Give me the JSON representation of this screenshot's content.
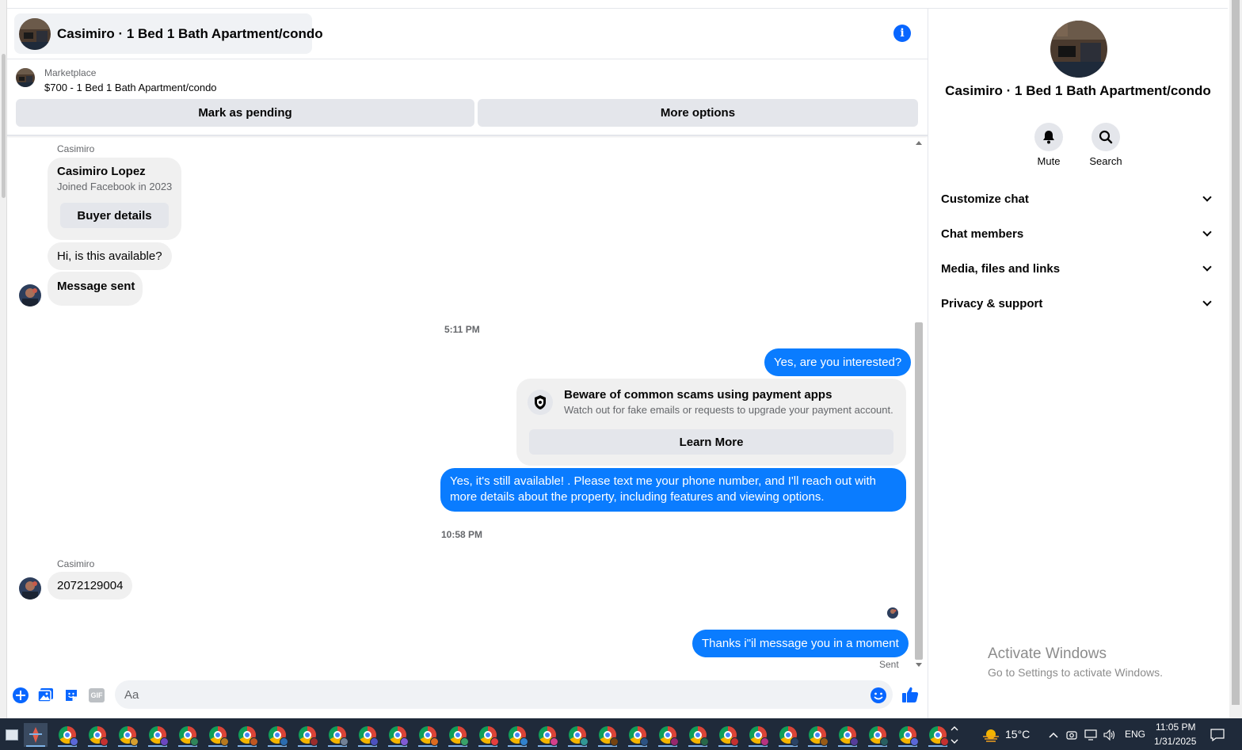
{
  "header": {
    "chat_title": "Casimiro · 1 Bed 1 Bath Apartment/condo"
  },
  "marketplace": {
    "label": "Marketplace",
    "listing": "$700 - 1 Bed 1 Bath Apartment/condo",
    "pending_button": "Mark as pending",
    "more_button": "More options"
  },
  "messages": {
    "sender_1": "Casimiro",
    "profile": {
      "name": "Casimiro Lopez",
      "joined": "Joined Facebook in 2023",
      "button": "Buyer details"
    },
    "in_1": "Hi, is this available?",
    "in_2": "Message sent",
    "time_1": "5:11 PM",
    "out_1": "Yes, are you interested?",
    "scam": {
      "title": "Beware of common scams using payment apps",
      "text": "Watch out for fake emails or requests to upgrade your payment account.",
      "button": "Learn More"
    },
    "out_2": "Yes, it's still available! . Please text me your phone number, and I'll reach out with more details about the property, including features and viewing options.",
    "time_2": "10:58 PM",
    "sender_2": "Casimiro",
    "in_3": "2072129004",
    "out_3": "Thanks i\"il message you in a moment",
    "status": "Sent"
  },
  "composer": {
    "placeholder": "Aa",
    "gif_label": "GIF"
  },
  "right_panel": {
    "title": "Casimiro · 1 Bed 1 Bath Apartment/condo",
    "mute": "Mute",
    "search": "Search",
    "sections": [
      "Customize chat",
      "Chat members",
      "Media, files and links",
      "Privacy & support"
    ]
  },
  "watermark": {
    "line1": "Activate Windows",
    "line2": "Go to Settings to activate Windows."
  },
  "taskbar": {
    "weather": "15°C",
    "lang": "ENG",
    "time": "11:05 PM",
    "date": "1/31/2025"
  },
  "colors": {
    "accent": "#0866ff",
    "outgoing_bubble": "#0a7cff",
    "incoming_bubble": "#f0f0f0"
  }
}
